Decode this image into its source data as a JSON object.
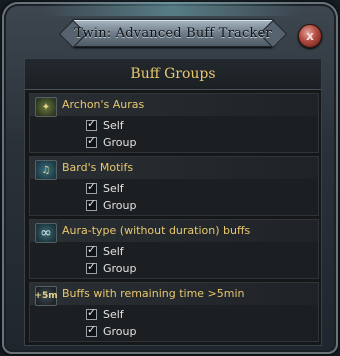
{
  "window": {
    "title": "Twin: Advanced Buff Tracker",
    "close_label": "x"
  },
  "header": {
    "title": "Buff Groups"
  },
  "groups": [
    {
      "icon": "aura-icon",
      "icon_glyph": "✦",
      "label": "Archon's Auras",
      "options": [
        {
          "label": "Self",
          "checked": true
        },
        {
          "label": "Group",
          "checked": true
        }
      ]
    },
    {
      "icon": "music-note-icon",
      "icon_glyph": "♫",
      "label": "Bard's Motifs",
      "options": [
        {
          "label": "Self",
          "checked": true
        },
        {
          "label": "Group",
          "checked": true
        }
      ]
    },
    {
      "icon": "infinity-icon",
      "icon_glyph": "∞",
      "label": "Aura-type (without duration) buffs",
      "options": [
        {
          "label": "Self",
          "checked": true
        },
        {
          "label": "Group",
          "checked": true
        }
      ]
    },
    {
      "icon": "plus-5m-icon",
      "icon_glyph": "+5m",
      "label": "Buffs with remaining time >5min",
      "options": [
        {
          "label": "Self",
          "checked": true
        },
        {
          "label": "Group",
          "checked": true
        }
      ]
    }
  ]
}
